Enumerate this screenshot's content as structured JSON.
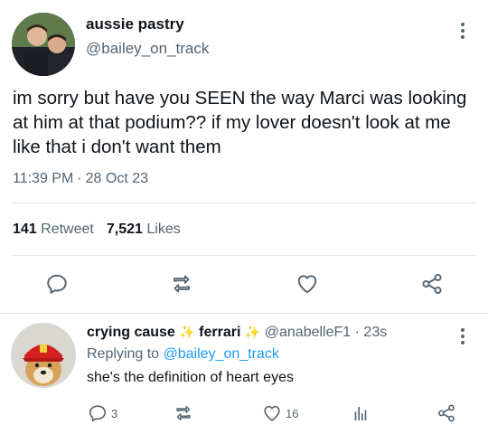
{
  "tweet": {
    "display_name": "aussie pastry",
    "handle": "@bailey_on_track",
    "text": "im sorry but have you SEEN the way Marci was looking at him at that podium?? if my lover doesn't look at me like that i don't want them",
    "time": "11:39 PM",
    "separator": "·",
    "date": "28 Oct 23",
    "retweets": {
      "count": "141",
      "label": "Retweet"
    },
    "likes": {
      "count": "7,521",
      "label": "Likes"
    },
    "icons": [
      "avatar-photo",
      "more-vertical-icon",
      "reply-icon",
      "retweet-icon",
      "like-icon",
      "share-icon"
    ]
  },
  "reply": {
    "display_name_part1": "crying cause",
    "display_name_part2": "ferrari",
    "sparkle": "✨",
    "handle": "@anabelleF1",
    "separator": "·",
    "time": "23s",
    "replying_prefix": "Replying to",
    "replying_to": "@bailey_on_track",
    "text": "she's the definition of heart eyes",
    "reply_count": "3",
    "like_count": "16",
    "icons": [
      "reply-icon",
      "retweet-icon",
      "like-icon",
      "analytics-icon",
      "share-icon"
    ]
  },
  "colors": {
    "text": "#0f1419",
    "secondary": "#536471",
    "link": "#1d9bf0",
    "divider": "#e6e6e6"
  }
}
